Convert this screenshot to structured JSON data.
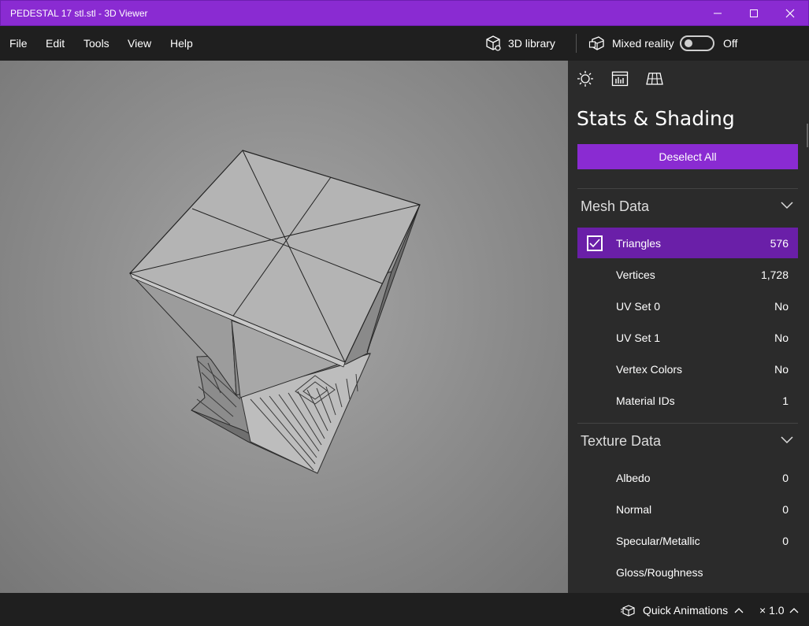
{
  "window": {
    "title": "PEDESTAL 17 stl.stl - 3D Viewer",
    "controls": [
      "minimize",
      "maximize",
      "close"
    ]
  },
  "menu": {
    "items": [
      "File",
      "Edit",
      "Tools",
      "View",
      "Help"
    ],
    "library_label": "3D library",
    "mixed_reality_label": "Mixed reality",
    "mixed_reality_state": "Off"
  },
  "panel": {
    "tabs": [
      "environment-and-lighting",
      "stats-and-shading",
      "mesh-grid"
    ],
    "active_tab": "stats-and-shading",
    "title": "Stats & Shading",
    "deselect_label": "Deselect All",
    "mesh_section": {
      "title": "Mesh Data",
      "rows": [
        {
          "name": "Triangles",
          "value": "576",
          "checked": true
        },
        {
          "name": "Vertices",
          "value": "1,728"
        },
        {
          "name": "UV Set 0",
          "value": "No"
        },
        {
          "name": "UV Set 1",
          "value": "No"
        },
        {
          "name": "Vertex Colors",
          "value": "No"
        },
        {
          "name": "Material IDs",
          "value": "1"
        }
      ]
    },
    "texture_section": {
      "title": "Texture Data",
      "rows": [
        {
          "name": "Albedo",
          "value": "0"
        },
        {
          "name": "Normal",
          "value": "0"
        },
        {
          "name": "Specular/Metallic",
          "value": "0"
        },
        {
          "name": "Gloss/Roughness",
          "value": ""
        }
      ]
    }
  },
  "status": {
    "quick_animations_label": "Quick Animations",
    "speed_label": "× 1.0"
  },
  "colors": {
    "accent": "#8a2bd2",
    "selected_row": "#6a1fa8",
    "panel_bg": "#2b2b2b",
    "chrome_bg": "#1f1f1f"
  }
}
